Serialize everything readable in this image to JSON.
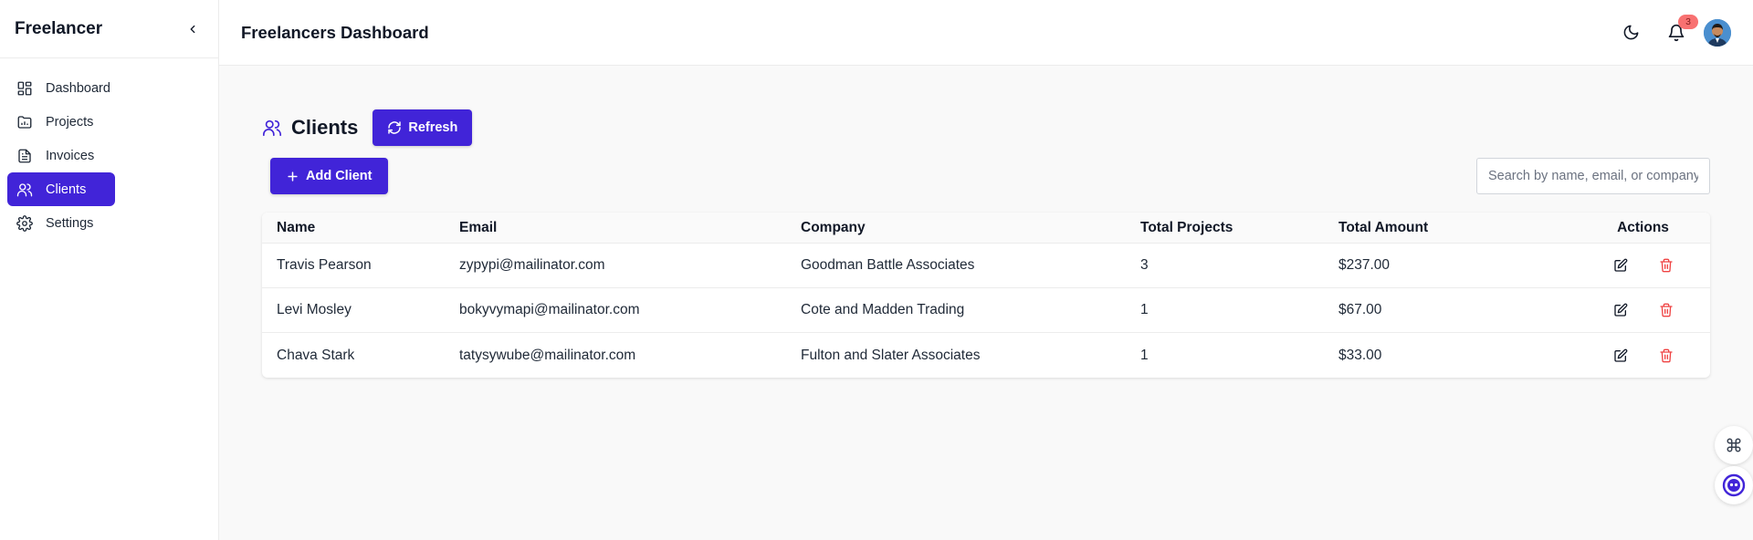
{
  "sidebar": {
    "brand": "Freelancer",
    "items": [
      {
        "label": "Dashboard",
        "icon": "dashboard-icon"
      },
      {
        "label": "Projects",
        "icon": "projects-icon"
      },
      {
        "label": "Invoices",
        "icon": "invoices-icon"
      },
      {
        "label": "Clients",
        "icon": "clients-icon"
      },
      {
        "label": "Settings",
        "icon": "settings-icon"
      }
    ],
    "active_item": "Clients"
  },
  "header": {
    "title": "Freelancers Dashboard",
    "notification_count": "3"
  },
  "clients": {
    "title": "Clients",
    "refresh_label": "Refresh",
    "add_label": "Add Client",
    "search_placeholder": "Search by name, email, or company",
    "columns": [
      "Name",
      "Email",
      "Company",
      "Total Projects",
      "Total Amount",
      "Actions"
    ],
    "rows": [
      {
        "name": "Travis Pearson",
        "email": "zypypi@mailinator.com",
        "company": "Goodman Battle Associates",
        "projects": "3",
        "amount": "$237.00"
      },
      {
        "name": "Levi Mosley",
        "email": "bokyvymapi@mailinator.com",
        "company": "Cote and Madden Trading",
        "projects": "1",
        "amount": "$67.00"
      },
      {
        "name": "Chava Stark",
        "email": "tatysywube@mailinator.com",
        "company": "Fulton and Slater Associates",
        "projects": "1",
        "amount": "$33.00"
      }
    ]
  },
  "colors": {
    "accent": "#4124d8",
    "danger": "#ef4444",
    "badge": "#f87171"
  }
}
